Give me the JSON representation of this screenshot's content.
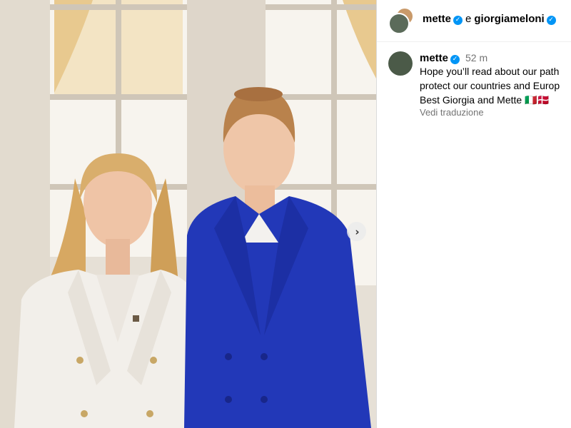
{
  "post": {
    "author": "mette",
    "conjunction": "e",
    "coauthor": "giorgiameloni",
    "verified_mark": "✓",
    "next_icon": "›"
  },
  "caption": {
    "username": "mette",
    "time": "52 m",
    "lines": [
      "Hope you’ll read about our path",
      "protect our countries and Europ",
      "Best Giorgia and Mette 🇮🇹🇩🇰"
    ],
    "translate_label": "Vedi traduzione"
  },
  "colors": {
    "verified": "#0095f6",
    "secondary_text": "#737373",
    "blazer_blue": "#2238b8",
    "blazer_white": "#f2efea"
  },
  "icons": [
    "verified-badge-icon",
    "chevron-right-icon"
  ]
}
